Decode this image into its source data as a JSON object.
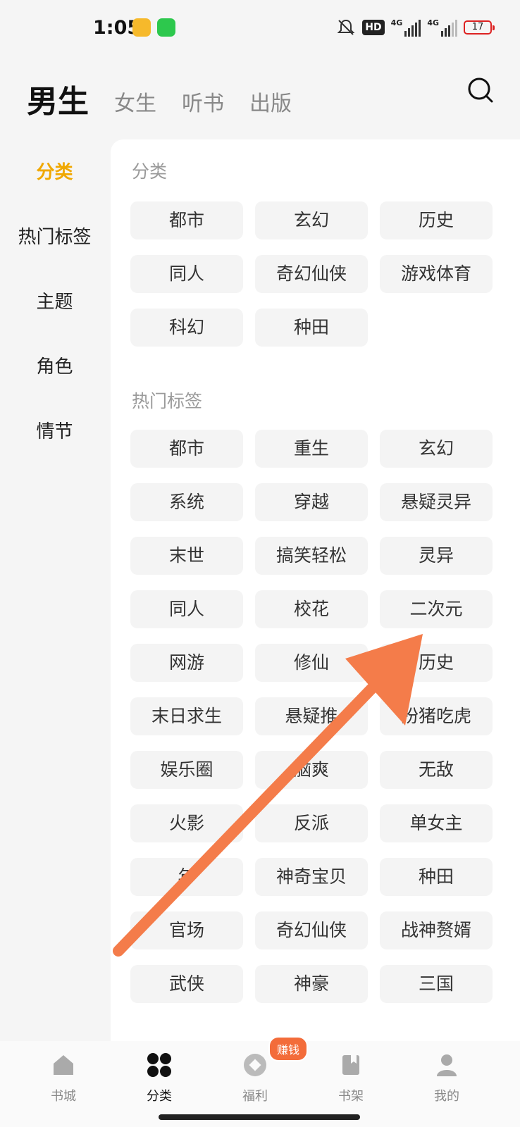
{
  "status_bar": {
    "time": "1:05",
    "hd_label": "HD",
    "network": [
      "4G",
      "4G"
    ],
    "battery": "17"
  },
  "top_tabs": {
    "main": "男生",
    "others": [
      "女生",
      "听书",
      "出版"
    ]
  },
  "sidebar": {
    "items": [
      "分类",
      "热门标签",
      "主题",
      "角色",
      "情节"
    ],
    "active_index": 0
  },
  "sections": [
    {
      "title": "分类",
      "tags": [
        "都市",
        "玄幻",
        "历史",
        "同人",
        "奇幻仙侠",
        "游戏体育",
        "科幻",
        "种田"
      ]
    },
    {
      "title": "热门标签",
      "tags": [
        "都市",
        "重生",
        "玄幻",
        "系统",
        "穿越",
        "悬疑灵异",
        "末世",
        "搞笑轻松",
        "灵异",
        "同人",
        "校花",
        "二次元",
        "网游",
        "修仙",
        "历史",
        "末日求生",
        "悬疑推",
        "扮猪吃虎",
        "娱乐圈",
        "脑爽",
        "无敌",
        "火影",
        "反派",
        "单女主",
        "年",
        "神奇宝贝",
        "种田",
        "官场",
        "奇幻仙侠",
        "战神赘婿",
        "武侠",
        "神豪",
        "三国"
      ]
    }
  ],
  "bottom_nav": {
    "items": [
      "书城",
      "分类",
      "福利",
      "书架",
      "我的"
    ],
    "active_index": 1,
    "badge": "赚钱"
  },
  "colors": {
    "accent": "#f0a800",
    "arrow": "#f47c4a",
    "chip_bg": "#f4f4f4",
    "badge": "#f36c3a"
  }
}
